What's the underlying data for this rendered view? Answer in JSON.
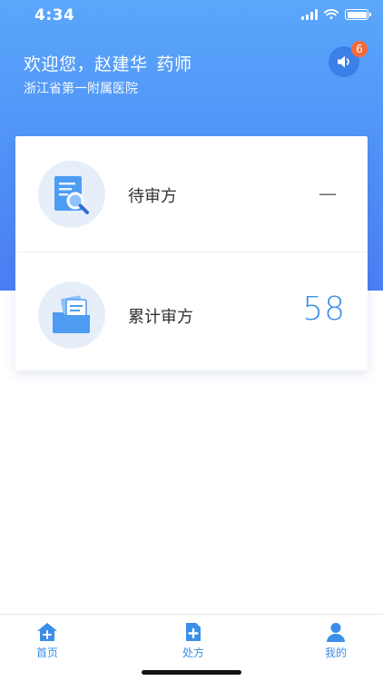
{
  "status_bar": {
    "time": "4:34"
  },
  "header": {
    "greeting": "欢迎您，",
    "name": "赵建华",
    "role": "药师",
    "hospital": "浙江省第一附属医院",
    "notification_count": "6"
  },
  "stats": [
    {
      "label": "待审方",
      "value": "—"
    },
    {
      "label": "累计审方",
      "value": "58"
    }
  ],
  "tabs": [
    {
      "label": "首页"
    },
    {
      "label": "处方"
    },
    {
      "label": "我的"
    }
  ],
  "colors": {
    "accent": "#3b8fe8",
    "header_top": "#5aa7fb",
    "header_bottom": "#4c7ef3",
    "badge": "#f36a3b"
  }
}
